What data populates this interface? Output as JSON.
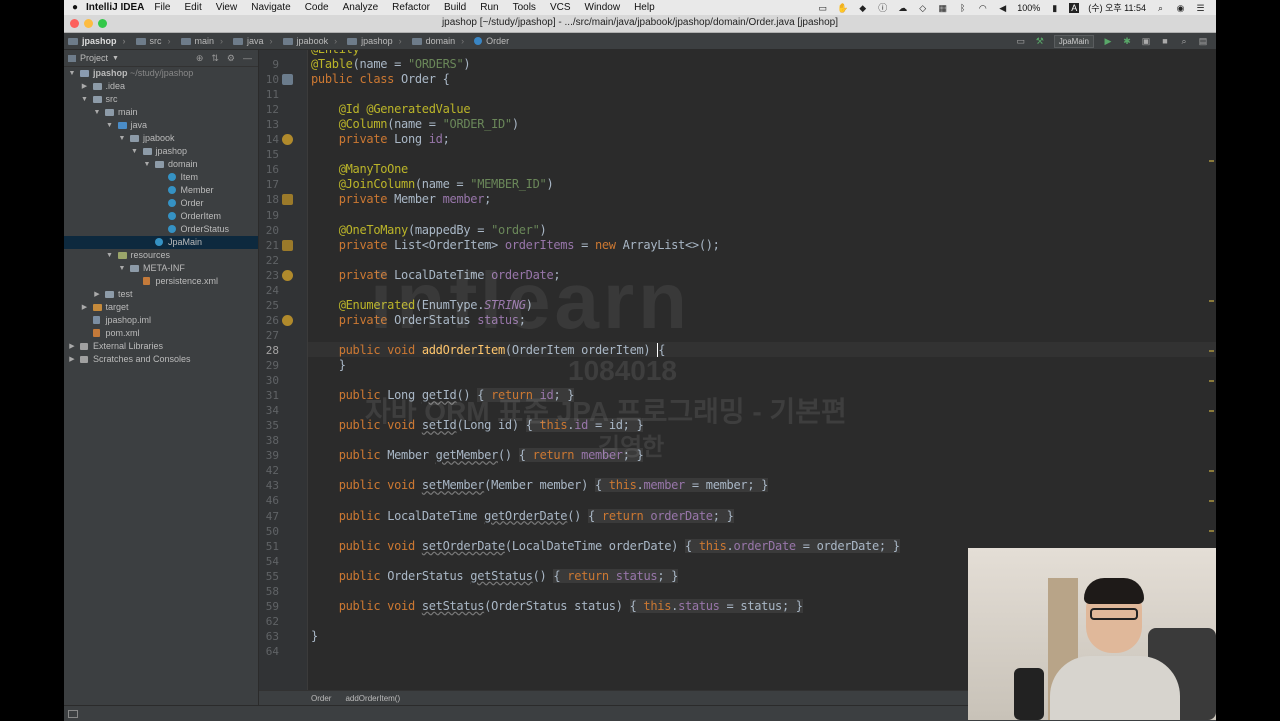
{
  "menubar": {
    "app_name": "IntelliJ IDEA",
    "items": [
      "File",
      "Edit",
      "View",
      "Navigate",
      "Code",
      "Analyze",
      "Refactor",
      "Build",
      "Run",
      "Tools",
      "VCS",
      "Window",
      "Help"
    ],
    "battery": "100%",
    "input_method": "A",
    "clock": "(수) 오후 11:54"
  },
  "window": {
    "title": "jpashop [~/study/jpashop] - .../src/main/java/jpabook/jpashop/domain/Order.java [jpashop]"
  },
  "navbar": {
    "breadcrumbs": [
      "jpashop",
      "src",
      "main",
      "java",
      "jpabook",
      "jpashop",
      "domain",
      "Order"
    ],
    "run_config": "JpaMain"
  },
  "project_panel": {
    "header": "Project",
    "tree": [
      {
        "label": "jpashop",
        "suffix": "~/study/jpashop",
        "depth": 0,
        "icon": "module",
        "arrow": "down"
      },
      {
        "label": ".idea",
        "depth": 1,
        "icon": "folder",
        "arrow": "right"
      },
      {
        "label": "src",
        "depth": 1,
        "icon": "folder",
        "arrow": "down"
      },
      {
        "label": "main",
        "depth": 2,
        "icon": "folder",
        "arrow": "down"
      },
      {
        "label": "java",
        "depth": 3,
        "icon": "src-folder",
        "arrow": "down"
      },
      {
        "label": "jpabook",
        "depth": 4,
        "icon": "folder",
        "arrow": "down"
      },
      {
        "label": "jpashop",
        "depth": 5,
        "icon": "folder",
        "arrow": "down"
      },
      {
        "label": "domain",
        "depth": 6,
        "icon": "folder",
        "arrow": "down"
      },
      {
        "label": "Item",
        "depth": 7,
        "icon": "cls",
        "arrow": ""
      },
      {
        "label": "Member",
        "depth": 7,
        "icon": "cls",
        "arrow": ""
      },
      {
        "label": "Order",
        "depth": 7,
        "icon": "cls",
        "arrow": ""
      },
      {
        "label": "OrderItem",
        "depth": 7,
        "icon": "cls",
        "arrow": ""
      },
      {
        "label": "OrderStatus",
        "depth": 7,
        "icon": "cls",
        "arrow": ""
      },
      {
        "label": "JpaMain",
        "depth": 6,
        "icon": "cls",
        "arrow": "",
        "selected": true
      },
      {
        "label": "resources",
        "depth": 3,
        "icon": "res-folder",
        "arrow": "down"
      },
      {
        "label": "META-INF",
        "depth": 4,
        "icon": "folder",
        "arrow": "down"
      },
      {
        "label": "persistence.xml",
        "depth": 5,
        "icon": "xml",
        "arrow": ""
      },
      {
        "label": "test",
        "depth": 2,
        "icon": "folder",
        "arrow": "right"
      },
      {
        "label": "target",
        "depth": 1,
        "icon": "target-folder",
        "arrow": "right"
      },
      {
        "label": "jpashop.iml",
        "depth": 1,
        "icon": "iml",
        "arrow": ""
      },
      {
        "label": "pom.xml",
        "depth": 1,
        "icon": "xml",
        "arrow": ""
      },
      {
        "label": "External Libraries",
        "depth": 0,
        "icon": "lib",
        "arrow": "right"
      },
      {
        "label": "Scratches and Consoles",
        "depth": 0,
        "icon": "lib",
        "arrow": "right"
      }
    ]
  },
  "editor": {
    "lines": [
      {
        "n": "9",
        "html": "<span class=\"ann\">@Table</span>(name = <span class=\"str\">\"ORDERS\"</span>)"
      },
      {
        "n": "10",
        "html": "<span class=\"kw\">public class</span> Order {"
      },
      {
        "n": "11",
        "html": ""
      },
      {
        "n": "12",
        "html": "    <span class=\"ann\">@Id @GeneratedValue</span>"
      },
      {
        "n": "13",
        "html": "    <span class=\"ann\">@Column</span>(name = <span class=\"str\">\"ORDER_ID\"</span>)"
      },
      {
        "n": "14",
        "html": "    <span class=\"kw\">private</span> Long <span class=\"field\">id</span>;"
      },
      {
        "n": "15",
        "html": ""
      },
      {
        "n": "16",
        "html": "    <span class=\"ann\">@ManyToOne</span>"
      },
      {
        "n": "17",
        "html": "    <span class=\"ann\">@JoinColumn</span>(name = <span class=\"str\">\"MEMBER_ID\"</span>)"
      },
      {
        "n": "18",
        "html": "    <span class=\"kw\">private</span> Member <span class=\"field\">member</span>;"
      },
      {
        "n": "19",
        "html": ""
      },
      {
        "n": "20",
        "html": "    <span class=\"ann\">@OneToMany</span>(mappedBy = <span class=\"str\">\"order\"</span>)"
      },
      {
        "n": "21",
        "html": "    <span class=\"kw\">private</span> List&lt;OrderItem&gt; <span class=\"field\">orderItems</span> = <span class=\"kw\">new</span> ArrayList&lt;&gt;();"
      },
      {
        "n": "22",
        "html": ""
      },
      {
        "n": "23",
        "html": "    <span class=\"kw\">private</span> LocalDateTime <span class=\"field\">orderDate</span>;"
      },
      {
        "n": "24",
        "html": ""
      },
      {
        "n": "25",
        "html": "    <span class=\"ann\">@Enumerated</span>(EnumType.<span class=\"enumc\">STRING</span>)"
      },
      {
        "n": "26",
        "html": "    <span class=\"kw\">private</span> OrderStatus <span class=\"field\">status</span>;"
      },
      {
        "n": "27",
        "html": ""
      },
      {
        "n": "28",
        "html": "    <span class=\"kw\">public void</span> <span class=\"method\">addOrderItem</span>(OrderItem orderItem) <span class=\"cursor\"></span>{",
        "caret": true
      },
      {
        "n": "29",
        "html": "    }"
      },
      {
        "n": "30",
        "html": ""
      },
      {
        "n": "31",
        "html": "    <span class=\"kw\">public</span> Long <span class=\"ul\">getId</span>() <span class=\"fold\">{ <span class=\"kw\">return</span> <span class=\"field\">id</span>; }</span>"
      },
      {
        "n": "34",
        "html": ""
      },
      {
        "n": "35",
        "html": "    <span class=\"kw\">public void</span> <span class=\"ul\">setId</span>(Long id) <span class=\"fold\">{ <span class=\"kw\">this</span>.<span class=\"field\">id</span> = id; }</span>"
      },
      {
        "n": "38",
        "html": ""
      },
      {
        "n": "39",
        "html": "    <span class=\"kw\">public</span> Member <span class=\"ul\">getMember</span>() <span class=\"fold\">{ <span class=\"kw\">return</span> <span class=\"field\">member</span>; }</span>"
      },
      {
        "n": "42",
        "html": ""
      },
      {
        "n": "43",
        "html": "    <span class=\"kw\">public void</span> <span class=\"ul\">setMember</span>(Member member) <span class=\"fold\">{ <span class=\"kw\">this</span>.<span class=\"field\">member</span> = member; }</span>"
      },
      {
        "n": "46",
        "html": ""
      },
      {
        "n": "47",
        "html": "    <span class=\"kw\">public</span> LocalDateTime <span class=\"ul\">getOrderDate</span>() <span class=\"fold\">{ <span class=\"kw\">return</span> <span class=\"field\">orderDate</span>; }</span>"
      },
      {
        "n": "50",
        "html": ""
      },
      {
        "n": "51",
        "html": "    <span class=\"kw\">public void</span> <span class=\"ul\">setOrderDate</span>(LocalDateTime orderDate) <span class=\"fold\">{ <span class=\"kw\">this</span>.<span class=\"field\">orderDate</span> = orderDate; }</span>"
      },
      {
        "n": "54",
        "html": ""
      },
      {
        "n": "55",
        "html": "    <span class=\"kw\">public</span> OrderStatus <span class=\"ul\">getStatus</span>() <span class=\"fold\">{ <span class=\"kw\">return</span> <span class=\"field\">status</span>; }</span>"
      },
      {
        "n": "58",
        "html": ""
      },
      {
        "n": "59",
        "html": "    <span class=\"kw\">public void</span> <span class=\"ul\">setStatus</span>(OrderStatus status) <span class=\"fold\">{ <span class=\"kw\">this</span>.<span class=\"field\">status</span> = status; }</span>"
      },
      {
        "n": "62",
        "html": ""
      },
      {
        "n": "63",
        "html": "}"
      },
      {
        "n": "64",
        "html": ""
      }
    ]
  },
  "editor_breadcrumbs": [
    "Order",
    "addOrderItem()"
  ],
  "watermark": {
    "logo": "inflearn",
    "id": "1084018",
    "course": "자바 ORM 표준 JPA 프로그래밍 - 기본편",
    "name": "김영한"
  },
  "colors": {
    "editor_bg": "#2b2b2b",
    "keyword": "#cc7832",
    "annotation": "#bbb529",
    "string": "#6a8759",
    "field": "#9876aa",
    "method": "#ffc66d",
    "text": "#a9b7c6"
  }
}
